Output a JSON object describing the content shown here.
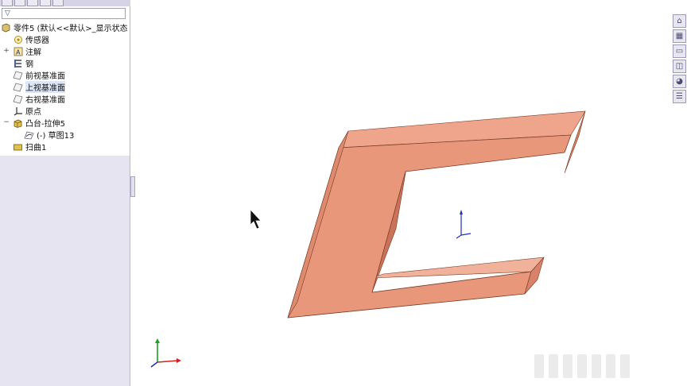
{
  "feature_tree": {
    "root_label": "零件5   (默认<<默认>_显示状态",
    "items": [
      {
        "label": "传感器",
        "icon": "sensor-icon"
      },
      {
        "label": "注解",
        "icon": "annotation-icon"
      },
      {
        "label": "钢",
        "icon": "material-icon"
      },
      {
        "label": "前视基准面",
        "icon": "plane-icon"
      },
      {
        "label": "上视基准面",
        "icon": "plane-icon"
      },
      {
        "label": "右视基准面",
        "icon": "plane-icon"
      },
      {
        "label": "原点",
        "icon": "origin-icon"
      },
      {
        "label": "凸台-拉伸5",
        "icon": "extrude-icon"
      },
      {
        "label": "(-) 草图13",
        "icon": "sketch-icon"
      },
      {
        "label": "扫曲1",
        "icon": "feature-icon"
      }
    ]
  },
  "model": {
    "face_color": "#e9977b",
    "face_shade_color": "#d9826a",
    "top_color": "#efa58c",
    "edge_color": "#7a3c26"
  },
  "task_pane": [
    "home-icon",
    "library-icon",
    "folder-icon",
    "view-palette-icon",
    "appearance-icon",
    "custom-properties-icon"
  ]
}
